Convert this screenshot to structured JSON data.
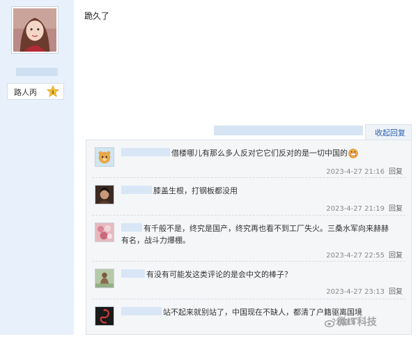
{
  "author": {
    "rank_label": "路人丙",
    "rank_badge": "1"
  },
  "post": {
    "text": "跪久了"
  },
  "replies_bar": {
    "collapse_label": "收起回复"
  },
  "comments": [
    {
      "text": "借楼哪儿有那么多人反对它它们反对的是一切中国的",
      "time": "2023-4-27 21:16",
      "reply": "回复"
    },
    {
      "text": "膝盖生根，打钢板都没用",
      "time": "2023-4-27 21:19",
      "reply": "回复"
    },
    {
      "text_line1": "有千般不是，终究是国产，终究再也看不到工厂失火。三桑水军向来赫赫",
      "text_line2": "有名，战斗力爆棚。",
      "time": "2023-4-27 22:55",
      "reply": "回复"
    },
    {
      "text": "有没有可能发这类评论的是会中文的棒子？",
      "time": "2023-4-27 23:13",
      "reply": "回复"
    },
    {
      "text": "站不起来就别站了，中国现在不缺人，都清了户籍驱离国境",
      "time": "2023-",
      "reply": ""
    }
  ],
  "watermark": {
    "text": "微IT科技"
  },
  "icons": [
    "avatar",
    "star-badge-icon",
    "emoji-icon",
    "weibo-logo-icon"
  ]
}
